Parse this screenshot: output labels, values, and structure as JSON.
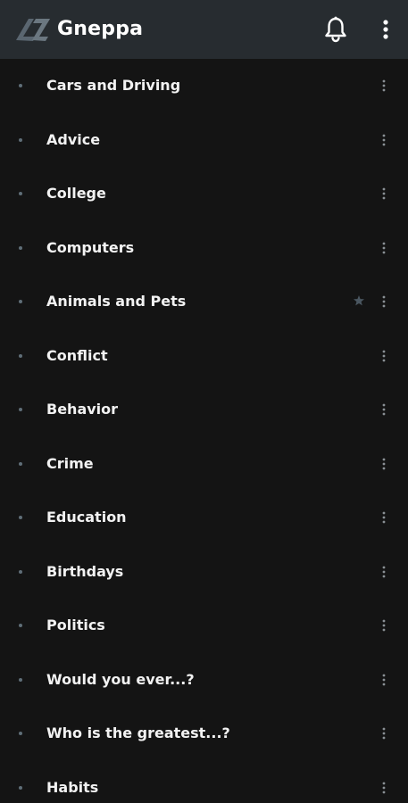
{
  "app": {
    "title": "Gneppa",
    "logo_icon": "gneppa-logo-icon",
    "notification_icon": "bell-icon",
    "overflow_icon": "more-vertical-icon"
  },
  "colors": {
    "appbar": "#272c30",
    "background": "#141414",
    "text": "#f2f2f2",
    "bullet": "#5f6e78",
    "star": "#4a5660",
    "menu_dots": "#8a9095"
  },
  "topics": [
    {
      "label": "Cars and Driving",
      "starred": false
    },
    {
      "label": "Advice",
      "starred": false
    },
    {
      "label": "College",
      "starred": false
    },
    {
      "label": "Computers",
      "starred": false
    },
    {
      "label": "Animals and Pets",
      "starred": true
    },
    {
      "label": "Conflict",
      "starred": false
    },
    {
      "label": "Behavior",
      "starred": false
    },
    {
      "label": "Crime",
      "starred": false
    },
    {
      "label": "Education",
      "starred": false
    },
    {
      "label": "Birthdays",
      "starred": false
    },
    {
      "label": "Politics",
      "starred": false
    },
    {
      "label": "Would you ever...?",
      "starred": false
    },
    {
      "label": "Who is the greatest...?",
      "starred": false
    },
    {
      "label": "Habits",
      "starred": false
    }
  ]
}
